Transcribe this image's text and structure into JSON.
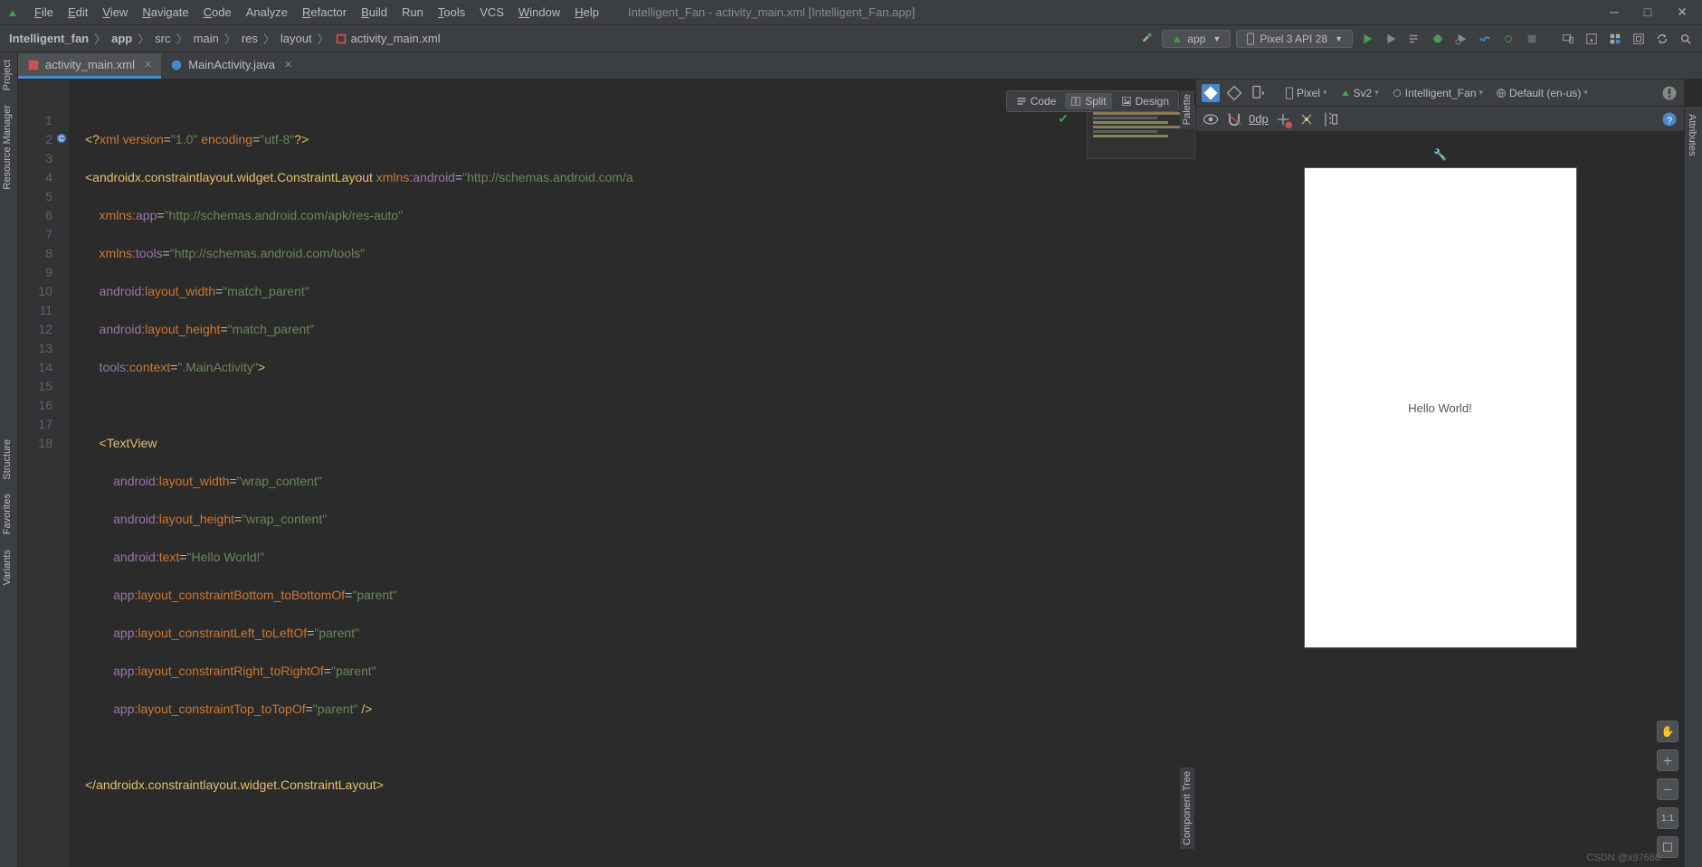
{
  "window": {
    "title": "Intelligent_Fan - activity_main.xml [Intelligent_Fan.app]"
  },
  "menu": {
    "file": "File",
    "edit": "Edit",
    "view": "View",
    "navigate": "Navigate",
    "code": "Code",
    "analyze": "Analyze",
    "refactor": "Refactor",
    "build": "Build",
    "run": "Run",
    "tools": "Tools",
    "vcs": "VCS",
    "window": "Window",
    "help": "Help"
  },
  "breadcrumbs": [
    "Intelligent_fan",
    "app",
    "src",
    "main",
    "res",
    "layout",
    "activity_main.xml"
  ],
  "toolbar": {
    "config": "app",
    "device": "Pixel 3 API 28"
  },
  "tabs": [
    {
      "label": "activity_main.xml",
      "active": true
    },
    {
      "label": "MainActivity.java",
      "active": false
    }
  ],
  "left_tools": [
    "Project",
    "Resource Manager",
    "Structure",
    "Favorites",
    "Variants"
  ],
  "right_tools": [
    "Attributes"
  ],
  "view_modes": {
    "code": "Code",
    "split": "Split",
    "design": "Design"
  },
  "code_text": {
    "l1_a": "<?",
    "l1_b": "xml version",
    "l1_c": "=",
    "l1_d": "\"1.0\"",
    "l1_e": " encoding",
    "l1_f": "=",
    "l1_g": "\"utf-8\"",
    "l1_h": "?>",
    "l2_a": "<androidx.constraintlayout.widget.ConstraintLayout",
    "l2_b": " xmlns:",
    "l2_c": "android",
    "l2_d": "=",
    "l2_e": "\"http://schemas.android.com/a",
    "l3_a": "    xmlns:",
    "l3_b": "app",
    "l3_c": "=",
    "l3_d": "\"http://schemas.android.com/apk/res-auto\"",
    "l4_a": "    xmlns:",
    "l4_b": "tools",
    "l4_c": "=",
    "l4_d": "\"http://schemas.android.com/tools\"",
    "l5_a": "    android",
    "l5_b": ":layout_width",
    "l5_c": "=",
    "l5_d": "\"match_parent\"",
    "l6_a": "    android",
    "l6_b": ":layout_height",
    "l6_c": "=",
    "l6_d": "\"match_parent\"",
    "l7_a": "    tools",
    "l7_b": ":context",
    "l7_c": "=",
    "l7_d": "\".MainActivity\"",
    "l7_e": ">",
    "l9_a": "    <TextView",
    "l10_a": "        android",
    "l10_b": ":layout_width",
    "l10_c": "=",
    "l10_d": "\"wrap_content\"",
    "l11_a": "        android",
    "l11_b": ":layout_height",
    "l11_c": "=",
    "l11_d": "\"wrap_content\"",
    "l12_a": "        android",
    "l12_b": ":text",
    "l12_c": "=",
    "l12_d": "\"Hello World!\"",
    "l13_a": "        app",
    "l13_b": ":layout_constraintBottom_toBottomOf",
    "l13_c": "=",
    "l13_d": "\"parent\"",
    "l14_a": "        app",
    "l14_b": ":layout_constraintLeft_toLeftOf",
    "l14_c": "=",
    "l14_d": "\"parent\"",
    "l15_a": "        app",
    "l15_b": ":layout_constraintRight_toRightOf",
    "l15_c": "=",
    "l15_d": "\"parent\"",
    "l16_a": "        app",
    "l16_b": ":layout_constraintTop_toTopOf",
    "l16_c": "=",
    "l16_d": "\"parent\"",
    "l16_e": " />",
    "l18_a": "</androidx.constraintlayout.widget.ConstraintLayout>"
  },
  "line_numbers": [
    "1",
    "2",
    "3",
    "4",
    "5",
    "6",
    "7",
    "8",
    "9",
    "10",
    "11",
    "12",
    "13",
    "14",
    "15",
    "16",
    "17",
    "18"
  ],
  "design_toolbar": {
    "pixel": "Pixel",
    "sv": "Sv2",
    "app": "Intelligent_Fan",
    "locale": "Default (en-us)",
    "zero": "0dp"
  },
  "preview": {
    "text": "Hello World!"
  },
  "side_labels": {
    "palette": "Palette",
    "ctree": "Component Tree"
  },
  "zoom": {
    "fit": "1:1"
  },
  "watermark": "CSDN @x97666"
}
